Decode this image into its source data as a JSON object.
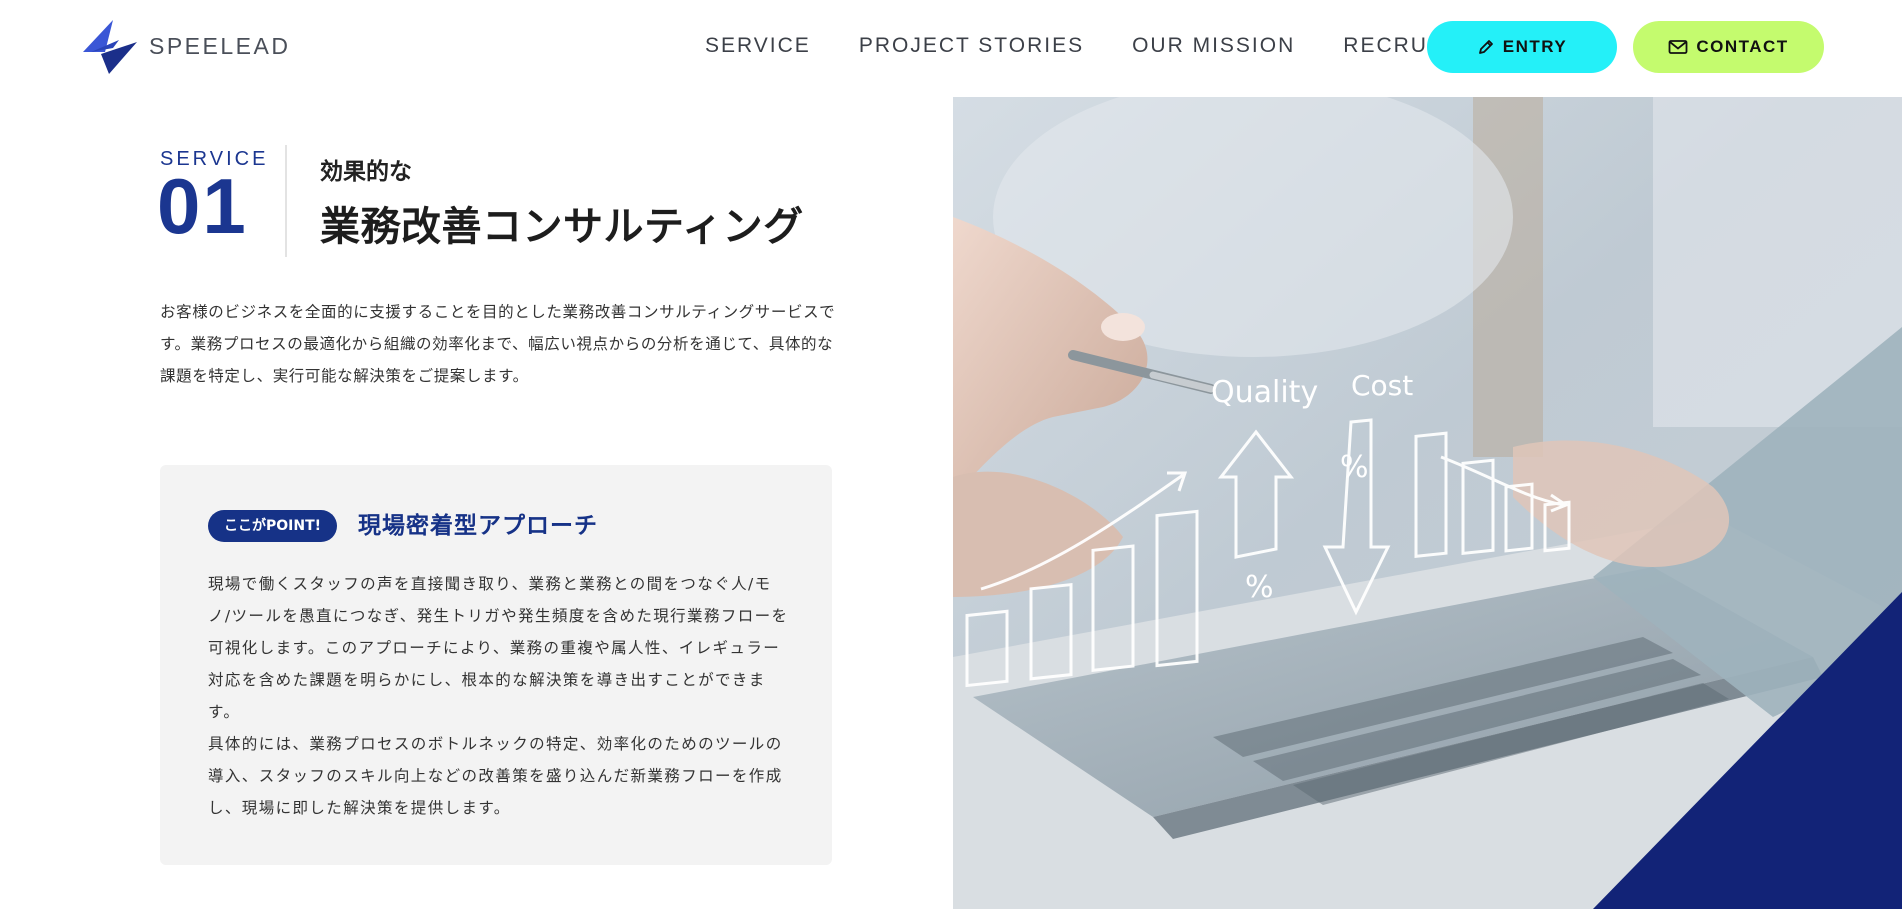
{
  "header": {
    "logo_text": "SPEELEAD",
    "nav": [
      "SERVICE",
      "PROJECT STORIES",
      "OUR MISSION",
      "RECRUIT"
    ],
    "entry_label": "ENTRY",
    "contact_label": "CONTACT"
  },
  "service": {
    "label": "SERVICE",
    "number": "01",
    "subtitle": "効果的な",
    "title": "業務改善コンサルティング",
    "description": "お客様のビジネスを全面的に支援することを目的とした業務改善コンサルティングサービスです。業務プロセスの最適化から組織の効率化まで、幅広い視点からの分析を通じて、具体的な課題を特定し、実行可能な解決策をご提案します。"
  },
  "point": {
    "badge": "ここがPOINT!",
    "title": "現場密着型アプローチ",
    "paragraph1": "現場で働くスタッフの声を直接聞き取り、業務と業務との間をつなぐ人/モノ/ツールを愚直につなぎ、発生トリガや発生頻度を含めた現行業務フローを可視化します。このアプローチにより、業務の重複や属人性、イレギュラー対応を含めた課題を明らかにし、根本的な解決策を導き出すことができます。",
    "paragraph2": "具体的には、業務プロセスのボトルネックの特定、効率化のためのツールの導入、スタッフのスキル向上などの改善策を盛り込んだ新業務フローを作成し、現場に即した解決策を提供します。"
  },
  "hero_image": {
    "label_quality": "Quality",
    "label_cost": "Cost",
    "percent_1": "%",
    "percent_2": "%"
  },
  "colors": {
    "brand_navy": "#163287",
    "entry_cyan": "#24f0f8",
    "contact_lime": "#c4fb6e"
  }
}
